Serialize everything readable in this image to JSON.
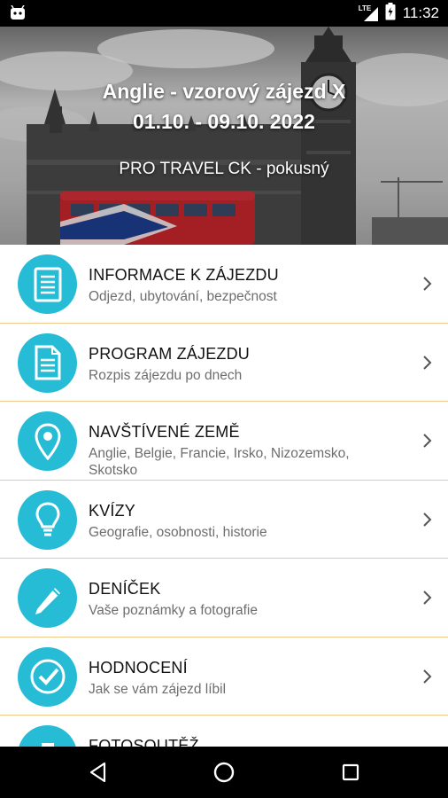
{
  "status_bar": {
    "time": "11:32",
    "network_label": "LTE",
    "icons": [
      "android-notification-icon",
      "lte-signal-icon",
      "battery-icon"
    ]
  },
  "hero": {
    "title": "Anglie - vzorový zájezd X",
    "dates": "01.10. - 09.10. 2022",
    "agency": "PRO TRAVEL CK - pokusný"
  },
  "menu": {
    "accent_color": "#26bcd6",
    "divider_color": "#f2c98a",
    "items": [
      {
        "title": "INFORMACE K ZÁJEZDU",
        "subtitle": "Odjezd, ubytování, bezpečnost",
        "icon": "document-lines-icon"
      },
      {
        "title": "PROGRAM ZÁJEZDU",
        "subtitle": "Rozpis zájezdu po dnech",
        "icon": "document-icon"
      },
      {
        "title": "NAVŠTÍVENÉ ZEMĚ",
        "subtitle": "Anglie, Belgie, Francie, Irsko, Nizozemsko, Skotsko",
        "icon": "map-pin-icon"
      },
      {
        "title": "KVÍZY",
        "subtitle": "Geografie, osobnosti, historie",
        "icon": "lightbulb-icon"
      },
      {
        "title": "DENÍČEK",
        "subtitle": "Vaše poznámky a fotografie",
        "icon": "pencil-icon"
      },
      {
        "title": "HODNOCENÍ",
        "subtitle": "Jak se vám zájezd líbil",
        "icon": "check-circle-icon"
      },
      {
        "title": "FOTOSOUTĚŽ",
        "subtitle": "",
        "icon": "camera-icon"
      }
    ]
  },
  "nav_bar": {
    "buttons": [
      "back-icon",
      "home-icon",
      "recents-icon"
    ]
  }
}
